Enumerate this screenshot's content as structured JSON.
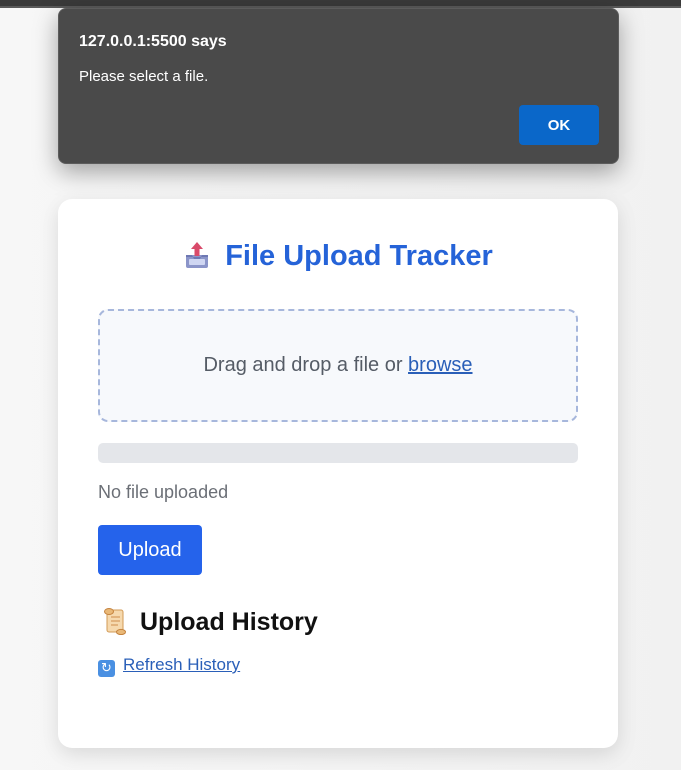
{
  "dialog": {
    "title": "127.0.0.1:5500 says",
    "message": "Please select a file.",
    "ok_label": "OK"
  },
  "app": {
    "title": "File Upload Tracker",
    "title_icon": "outbox-tray-icon",
    "dropzone": {
      "prompt": "Drag and drop a file or ",
      "browse_label": "browse"
    },
    "progress": 0,
    "status": "No file uploaded",
    "upload_label": "Upload",
    "history": {
      "title": "Upload History",
      "icon": "scroll-icon",
      "refresh_label": "Refresh History",
      "refresh_icon": "refresh-icon"
    }
  },
  "colors": {
    "accent": "#2563eb",
    "title": "#2563d8",
    "dialog_bg": "#4a4a4a",
    "dialog_button": "#0a67c9"
  }
}
